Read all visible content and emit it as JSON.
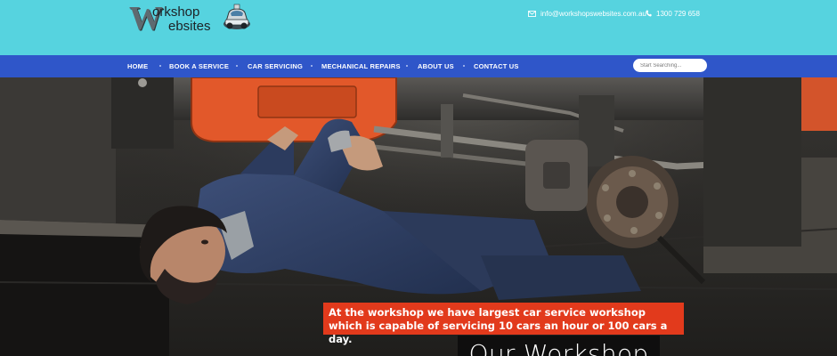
{
  "brand": {
    "logo_big_letter": "W",
    "logo_line1": "orkshop",
    "logo_line2": "ebsites",
    "logo_icon": "car-icon"
  },
  "contact": {
    "email": "info@workshopswebsites.com.au",
    "email_icon": "envelope-icon",
    "phone": "1300 729 658",
    "phone_icon": "phone-icon"
  },
  "nav": {
    "items": [
      {
        "label": "HOME"
      },
      {
        "label": "BOOK A SERVICE"
      },
      {
        "label": "CAR SERVICING"
      },
      {
        "label": "MECHANICAL REPAIRS"
      },
      {
        "label": "ABOUT US"
      },
      {
        "label": "CONTACT US"
      }
    ]
  },
  "search": {
    "placeholder": "Start Searching...",
    "value": ""
  },
  "hero": {
    "title": "Our Workshop",
    "caption_line1": "At the workshop we have largest car service workshop",
    "caption_line2": "which is capable of servicing 10 cars an hour or 100 cars a day."
  },
  "colors": {
    "header_bg": "#56d3df",
    "nav_bg": "#2f56c9",
    "caption_bg": "#e23a1c",
    "title_bg": "#0c0c0c"
  }
}
